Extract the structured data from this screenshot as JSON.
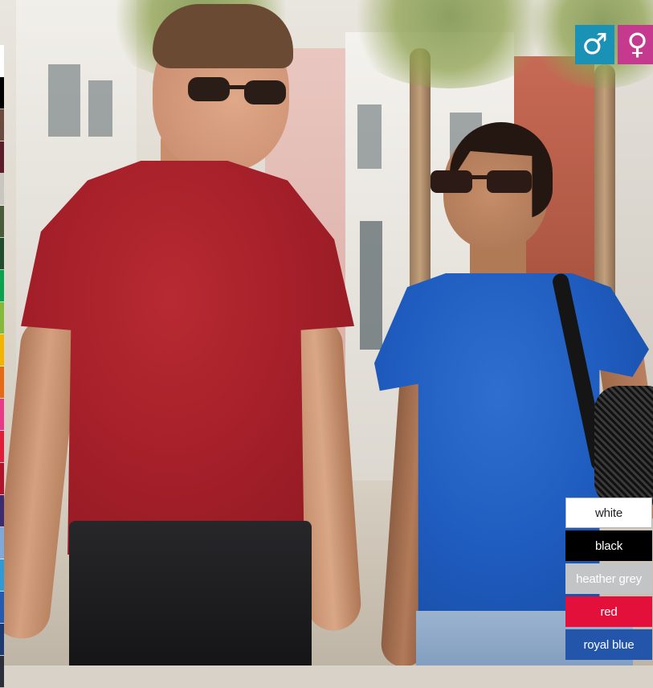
{
  "swatch_strip": {
    "colors": [
      "#ffffff",
      "#000000",
      "#6b4b3e",
      "#5c1d2b",
      "#c9c6c0",
      "#4a5b3a",
      "#1f4d2e",
      "#0aa14f",
      "#84b93a",
      "#f3b400",
      "#e66a14",
      "#e93a88",
      "#e21b39",
      "#b0132a",
      "#3c2b6e",
      "#7fa9d9",
      "#2e9ad6",
      "#245bb1",
      "#1b3a73",
      "#2b2f3a"
    ]
  },
  "gender_icons": [
    {
      "name": "male-icon",
      "glyph": "♂",
      "color": "#1a92b6"
    },
    {
      "name": "female-icon",
      "glyph": "♀",
      "color": "#c53a8f"
    }
  ],
  "color_legend": [
    {
      "label": "white",
      "bg": "#ffffff",
      "fg": "#222222",
      "border": "#b8b8b8"
    },
    {
      "label": "black",
      "bg": "#000000",
      "fg": "#ffffff",
      "border": "#000000"
    },
    {
      "label": "heather grey",
      "bg": "#c3c4c5",
      "fg": "#ffffff",
      "border": "#c3c4c5"
    },
    {
      "label": "red",
      "bg": "#e2103b",
      "fg": "#ffffff",
      "border": "#e2103b"
    },
    {
      "label": "royal blue",
      "bg": "#2356aa",
      "fg": "#ffffff",
      "border": "#2356aa"
    }
  ]
}
